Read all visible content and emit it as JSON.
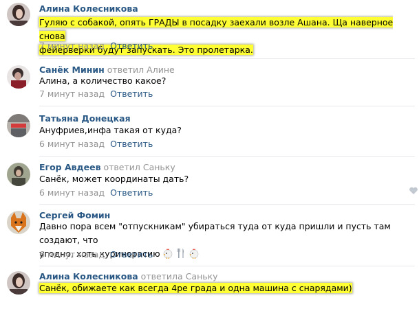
{
  "comments": [
    {
      "author": "Алина Колесникова",
      "replied_verb": "",
      "reply_to": "",
      "text_lines": [
        "Гуляю с собакой, опять ГРАДЫ в посадку заехали возле Ашана. Ща наверное снова",
        "фейерверки будут запускать. Это пролетарка."
      ],
      "time": "7 минут назад",
      "reply_label": "Ответить"
    },
    {
      "author": "Санёк Минин",
      "replied_verb": "ответил",
      "reply_to": "Алине",
      "text_lines": [
        "Алина, а количество какое?"
      ],
      "time": "7 минут назад",
      "reply_label": "Ответить"
    },
    {
      "author": "Татьяна Донецкая",
      "replied_verb": "",
      "reply_to": "",
      "text_lines": [
        "Ануфриев,инфа такая от куда?"
      ],
      "time": "6 минут назад",
      "reply_label": "Ответить"
    },
    {
      "author": "Егор Авдеев",
      "replied_verb": "ответил",
      "reply_to": "Саньку",
      "text_lines": [
        "Санёк, может координаты дать?"
      ],
      "time": "6 минут назад",
      "reply_label": "Ответить"
    },
    {
      "author": "Сергей Фомин",
      "replied_verb": "",
      "reply_to": "",
      "text_lines": [
        "Давно пора всем \"отпускникам\" убираться туда от куда пришли и пусть там создают, что",
        "угодно, хоть куринорасию"
      ],
      "time": "6 минут назад",
      "reply_label": "Ответить"
    },
    {
      "author": "Алина Колесникова",
      "replied_verb": "ответила",
      "reply_to": "Саньку",
      "text_lines": [
        "Санёк, обижаете как всегда 4ре града и одна машина с снарядами)"
      ],
      "time": "",
      "reply_label": ""
    }
  ],
  "colors": {
    "link": "#2a5885",
    "muted": "#939393",
    "highlight": "#ffff33",
    "separator": "#e7e8ec"
  },
  "icons": [
    "chicken-emoji-icon",
    "fork-knife-emoji-icon",
    "heart-like-icon"
  ]
}
